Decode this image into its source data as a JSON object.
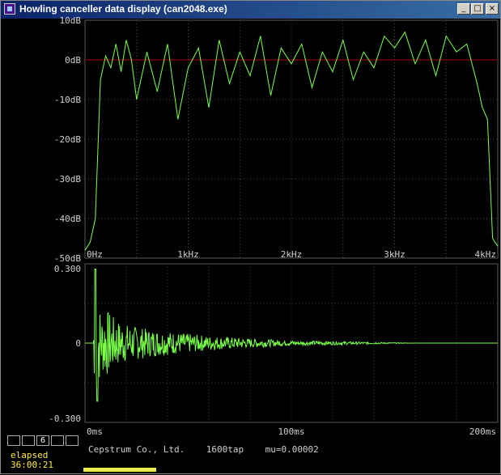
{
  "window": {
    "title": "Howling canceller data display (can2048.exe)"
  },
  "spectrum": {
    "y_ticks": [
      "10dB",
      "0dB",
      "-10dB",
      "-20dB",
      "-30dB",
      "-40dB",
      "-50dB"
    ],
    "x_ticks": [
      "0Hz",
      "1kHz",
      "2kHz",
      "3kHz",
      "4kHz"
    ],
    "reference_level": "0dB",
    "line_color": "#7aff4a",
    "reference_color": "#b00000"
  },
  "cepstrum": {
    "y_ticks": [
      "0.300",
      "0",
      "-0.300"
    ],
    "x_ticks": [
      "0ms",
      "100ms",
      "200ms"
    ],
    "line_color": "#7aff4a"
  },
  "status": {
    "company": "Cepstrum Co., Ltd.",
    "taps": "1600tap",
    "mu": "mu=0.00002"
  },
  "channels": [
    {
      "label": ""
    },
    {
      "label": ""
    },
    {
      "label": "6"
    },
    {
      "label": ""
    },
    {
      "label": ""
    }
  ],
  "elapsed": {
    "label": "elapsed",
    "time": "36:00:21",
    "progress": 0.17
  },
  "chart_data": [
    {
      "type": "line",
      "title": "",
      "xlabel": "",
      "ylabel": "",
      "x_unit": "Hz",
      "y_unit": "dB",
      "xlim": [
        0,
        4000
      ],
      "ylim": [
        -50,
        10
      ],
      "grid": true,
      "series": [
        {
          "x": [
            0,
            50,
            100,
            150,
            200,
            250,
            300,
            350,
            400,
            450,
            500,
            600,
            700,
            800,
            900,
            1000,
            1100,
            1200,
            1300,
            1400,
            1500,
            1600,
            1700,
            1800,
            1900,
            2000,
            2100,
            2200,
            2300,
            2400,
            2500,
            2600,
            2700,
            2800,
            2900,
            3000,
            3100,
            3200,
            3300,
            3400,
            3500,
            3600,
            3700,
            3800,
            3850,
            3900,
            3950,
            4000
          ],
          "y": [
            -48,
            -46,
            -40,
            -5,
            1,
            -2,
            4,
            -3,
            5,
            0,
            -10,
            2,
            -8,
            4,
            -15,
            -2,
            3,
            -12,
            5,
            -6,
            2,
            -4,
            6,
            -9,
            3,
            -1,
            4,
            -7,
            2,
            -3,
            5,
            -5,
            2,
            -2,
            6,
            3,
            7,
            -1,
            5,
            -4,
            6,
            2,
            4,
            -6,
            -12,
            -15,
            -45,
            -47
          ]
        }
      ]
    },
    {
      "type": "line",
      "title": "",
      "xlabel": "",
      "ylabel": "",
      "x_unit": "ms",
      "xlim": [
        0,
        200
      ],
      "ylim": [
        -0.3,
        0.3
      ],
      "grid": true,
      "series": [
        {
          "x": [
            0,
            4,
            5,
            6,
            8,
            10,
            15,
            20,
            30,
            40,
            50,
            60,
            70,
            80,
            100,
            120,
            140,
            160,
            200
          ],
          "y": [
            0,
            0.05,
            0.28,
            -0.22,
            0.12,
            -0.15,
            0.1,
            -0.08,
            0.06,
            -0.05,
            0.04,
            -0.03,
            0.025,
            -0.02,
            0.01,
            -0.008,
            0.004,
            0,
            0
          ]
        }
      ]
    }
  ]
}
